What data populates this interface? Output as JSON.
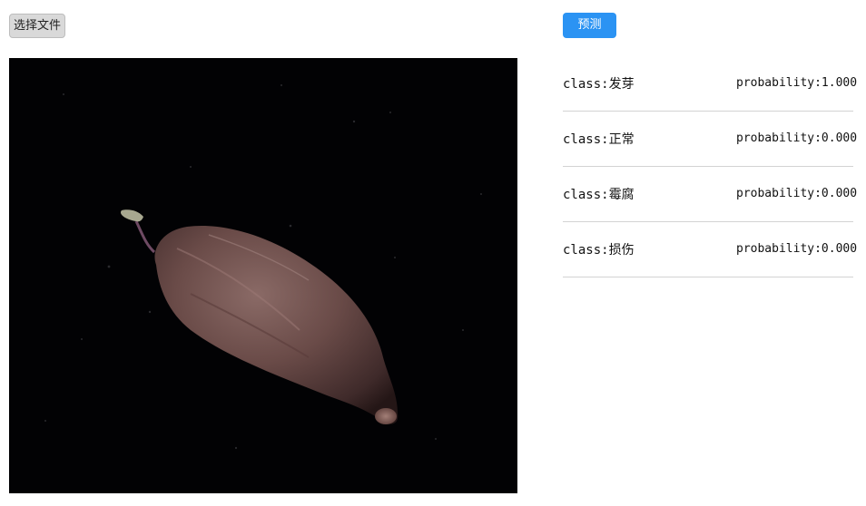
{
  "toolbar": {
    "choose_file_label": "选择文件",
    "predict_label": "预测"
  },
  "image": {
    "description_icon": "sweet-potato-photo"
  },
  "results": [
    {
      "class_label": "class:发芽",
      "probability_label": "probability:1.000"
    },
    {
      "class_label": "class:正常",
      "probability_label": "probability:0.000"
    },
    {
      "class_label": "class:霉腐",
      "probability_label": "probability:0.000"
    },
    {
      "class_label": "class:损伤",
      "probability_label": "probability:0.000"
    }
  ],
  "colors": {
    "accent": "#2b93f3",
    "divider": "#d3d3d3"
  }
}
